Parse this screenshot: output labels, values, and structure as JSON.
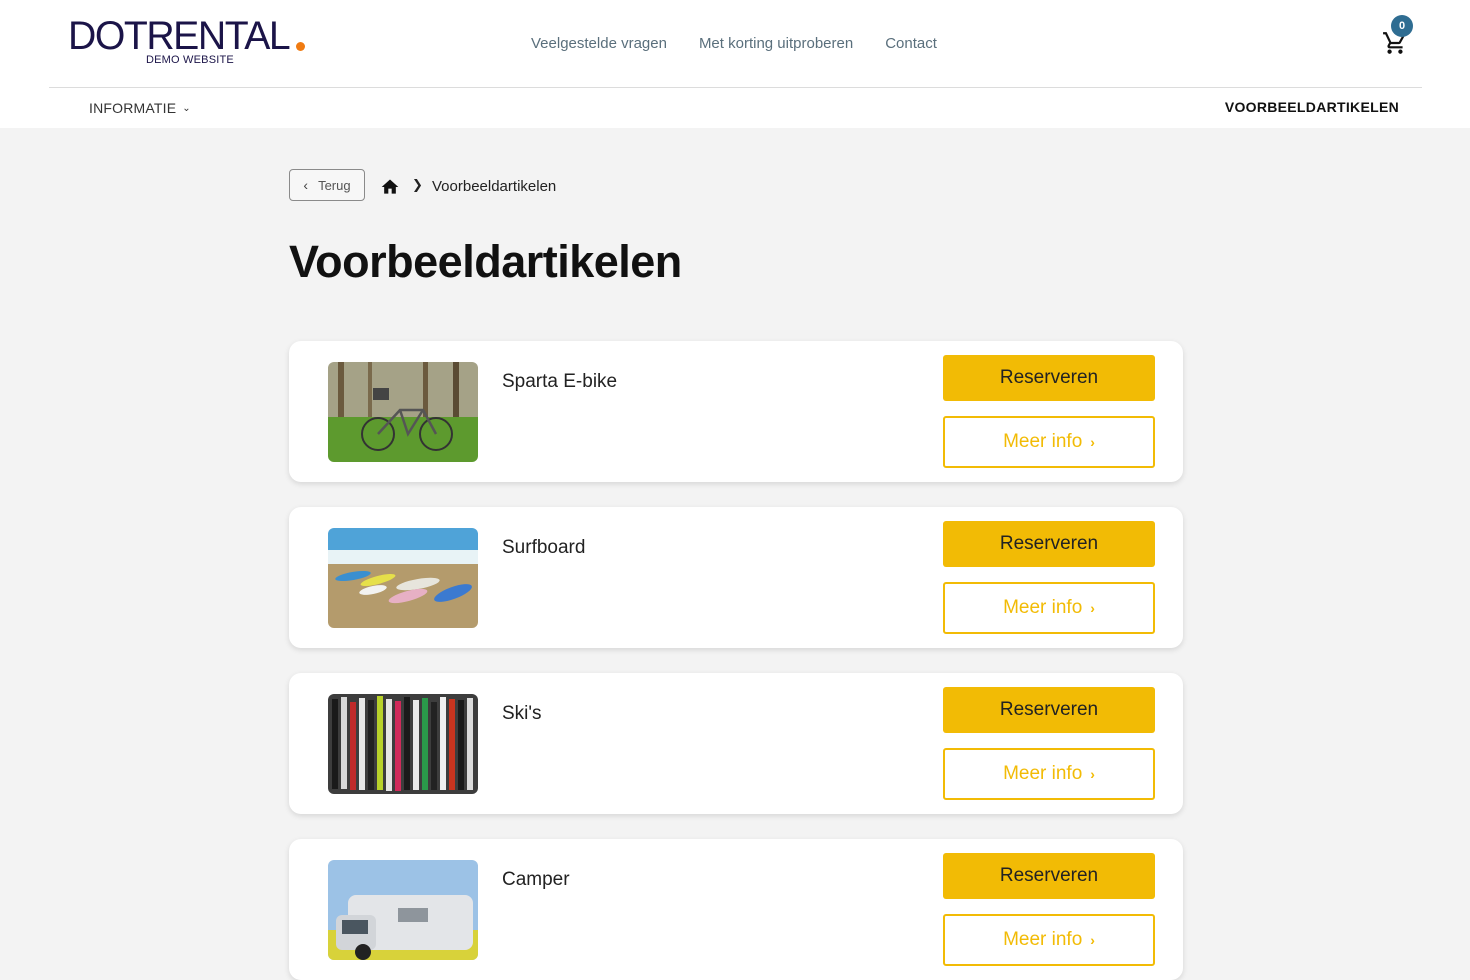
{
  "brand": {
    "logo_main": "DOTRENTAL",
    "logo_sub": "DEMO WEBSITE",
    "accent_dot_color": "#f07b12",
    "primary_color": "#1b1448"
  },
  "topnav": [
    {
      "label": "Veelgestelde vragen"
    },
    {
      "label": "Met korting uitproberen"
    },
    {
      "label": "Contact"
    }
  ],
  "cart": {
    "count": "0",
    "icon": "cart-icon"
  },
  "subnav": {
    "info_label": "INFORMATIE",
    "examples_label": "VOORBEELDARTIKELEN"
  },
  "breadcrumb": {
    "back_label": "Terug",
    "home_icon": "home-icon",
    "current": "Voorbeeldartikelen"
  },
  "page_title": "Voorbeeldartikelen",
  "products": [
    {
      "name": "Sparta E-bike",
      "reserve_label": "Reserveren",
      "info_label": "Meer info"
    },
    {
      "name": "Surfboard",
      "reserve_label": "Reserveren",
      "info_label": "Meer info"
    },
    {
      "name": "Ski's",
      "reserve_label": "Reserveren",
      "info_label": "Meer info"
    },
    {
      "name": "Camper",
      "reserve_label": "Reserveren",
      "info_label": "Meer info"
    }
  ],
  "colors": {
    "button_yellow": "#f2bb05",
    "background": "#f3f3f3",
    "badge": "#2f6d92"
  }
}
